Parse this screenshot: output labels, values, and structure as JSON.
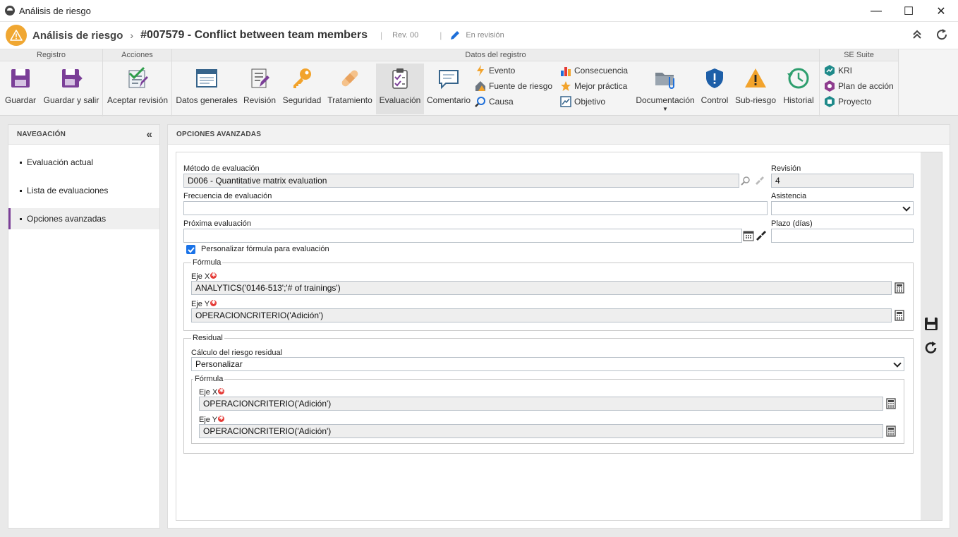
{
  "window": {
    "title": "Análisis de riesgo",
    "minimize": "—",
    "maximize": "☐",
    "close": "✕"
  },
  "header": {
    "module": "Análisis de riesgo",
    "record_title": "#007579 - Conflict between team members",
    "revision": "Rev. 00",
    "status": "En revisión"
  },
  "ribbon": {
    "groups": {
      "registro": "Registro",
      "acciones": "Acciones",
      "datos": "Datos del registro",
      "suite": "SE Suite"
    },
    "buttons": {
      "guardar": "Guardar",
      "guardar_salir": "Guardar y salir",
      "aceptar_revision": "Aceptar revisión",
      "datos_generales": "Datos generales",
      "revision": "Revisión",
      "seguridad": "Seguridad",
      "tratamiento": "Tratamiento",
      "evaluacion": "Evaluación",
      "comentario": "Comentario",
      "evento": "Evento",
      "fuente_riesgo": "Fuente de riesgo",
      "causa": "Causa",
      "consecuencia": "Consecuencia",
      "mejor_practica": "Mejor práctica",
      "objetivo": "Objetivo",
      "documentacion": "Documentación",
      "control": "Control",
      "sub_riesgo": "Sub-riesgo",
      "historial": "Historial",
      "kri": "KRI",
      "plan_accion": "Plan de acción",
      "proyecto": "Proyecto"
    }
  },
  "nav": {
    "title": "NAVEGACIÓN",
    "items": [
      "Evaluación actual",
      "Lista de evaluaciones",
      "Opciones avanzadas"
    ]
  },
  "main": {
    "title": "OPCIONES AVANZADAS",
    "metodo_label": "Método de evaluación",
    "metodo_value": "D006 - Quantitative matrix evaluation",
    "revision_label": "Revisión",
    "revision_value": "4",
    "frecuencia_label": "Frecuencia de evaluación",
    "frecuencia_value": "",
    "asistencia_label": "Asistencia",
    "asistencia_value": "",
    "proxima_label": "Próxima evaluación",
    "proxima_value": "",
    "plazo_label": "Plazo (días)",
    "plazo_value": "",
    "personalizar_label": "Personalizar fórmula para evaluación",
    "formula_legend": "Fórmula",
    "eje_x_label": "Eje X",
    "eje_x_value": "ANALYTICS('0146-513';'# of trainings')",
    "eje_y_label": "Eje Y",
    "eje_y_value": "OPERACIONCRITERIO('Adición')",
    "residual_legend": "Residual",
    "calculo_label": "Cálculo del riesgo residual",
    "calculo_value": "Personalizar",
    "res_formula_legend": "Fórmula",
    "res_eje_x_label": "Eje X",
    "res_eje_x_value": "OPERACIONCRITERIO('Adición')",
    "res_eje_y_label": "Eje Y",
    "res_eje_y_value": "OPERACIONCRITERIO('Adición')"
  },
  "colors": {
    "accent": "#7b3f98",
    "warning": "#f0a732",
    "checkbox": "#1a73e8"
  }
}
